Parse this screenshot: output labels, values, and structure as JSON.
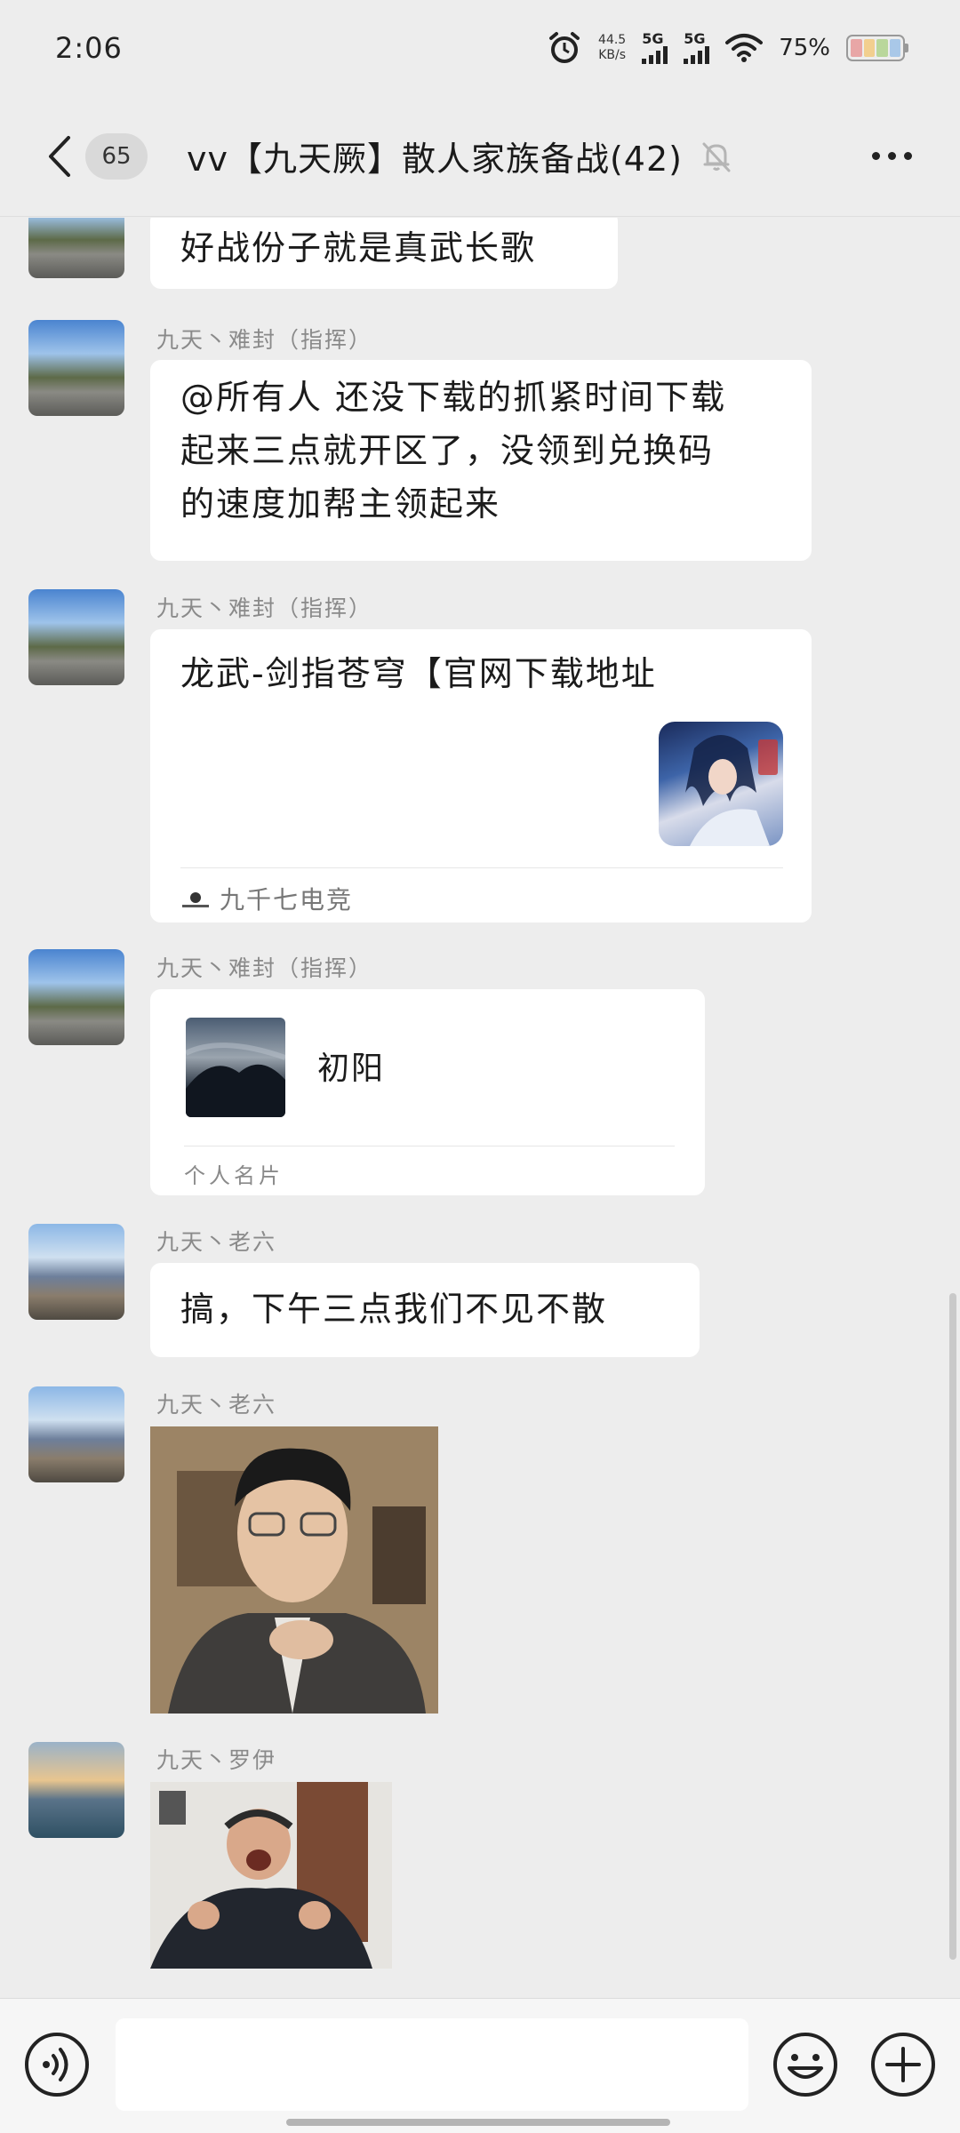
{
  "status_bar": {
    "time": "2:06",
    "net_speed_value": "44.5",
    "net_speed_unit": "KB/s",
    "signal_1": "5G",
    "signal_2": "5G",
    "battery_pct": "75%",
    "icons": [
      "alarm-icon",
      "signal-icon",
      "wifi-icon",
      "battery-icon"
    ]
  },
  "header": {
    "unread_count": "65",
    "title": "vv【九天厥】散人家族备战(42)",
    "icons": [
      "back-arrow-icon",
      "mute-bell-icon",
      "more-dots-icon"
    ]
  },
  "messages": [
    {
      "type": "text",
      "text": "好战份子就是真武长歌"
    },
    {
      "type": "text",
      "sender": "九天丶难封（指挥）",
      "lines": [
        "@所有人 还没下载的抓紧时间下载",
        "起来三点就开区了，没领到兑换码",
        "的速度加帮主领起来"
      ]
    },
    {
      "type": "link",
      "sender": "九天丶难封（指挥）",
      "title": "龙武-剑指苍穹【官网下载地址",
      "source": "九千七电竞"
    },
    {
      "type": "contact_card",
      "sender": "九天丶难封（指挥）",
      "name": "初阳",
      "card_label": "个人名片"
    },
    {
      "type": "text",
      "sender": "九天丶老六",
      "text": "搞，下午三点我们不见不散"
    },
    {
      "type": "sticker",
      "sender": "九天丶老六"
    },
    {
      "type": "sticker",
      "sender": "九天丶罗伊"
    }
  ],
  "input": {
    "value": "",
    "icons": [
      "voice-icon",
      "emoji-icon",
      "plus-icon"
    ]
  },
  "colors": {
    "background": "#ededed",
    "bubble": "#ffffff",
    "sender_text": "#8a8a8a",
    "battery_segments": [
      "#e8a6a6",
      "#f2cf8f",
      "#b9d79b",
      "#a9c8e8"
    ]
  }
}
